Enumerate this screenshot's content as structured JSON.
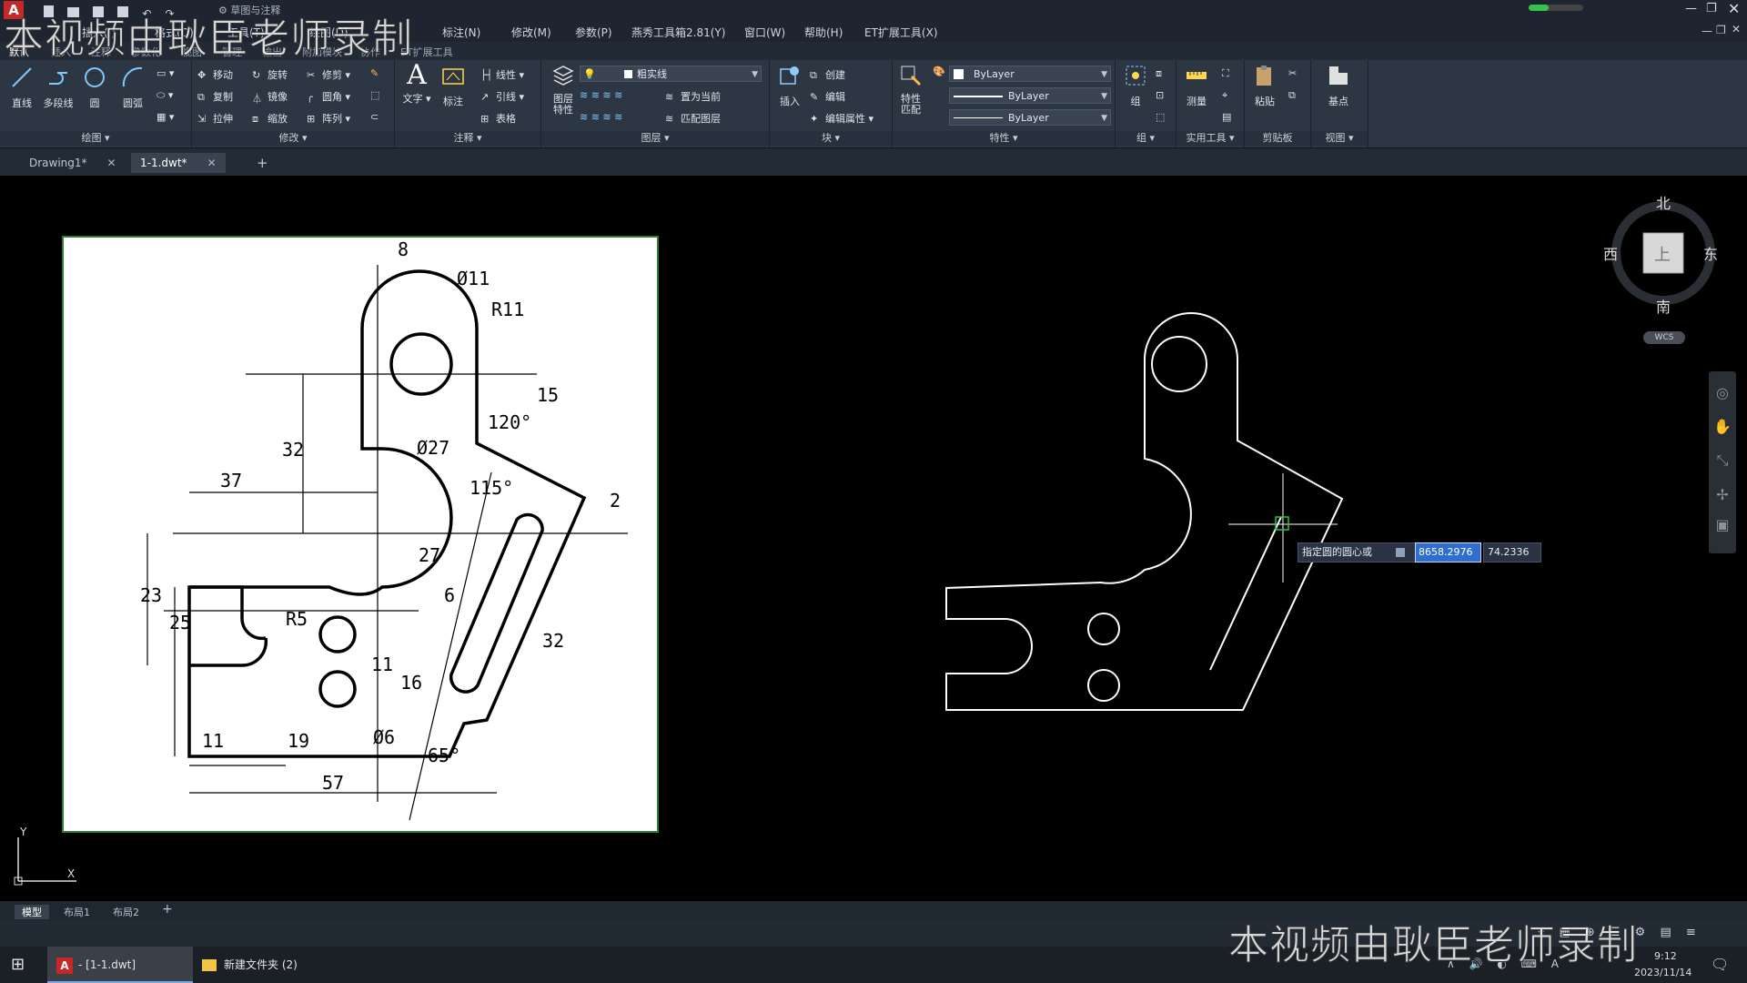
{
  "app": {
    "title_tab": "草图与注释",
    "colors": {
      "accent": "#e8333a",
      "ribbon_bg": "#2d3643",
      "canvas": "#000000",
      "paper": "#ffffff",
      "selection": "#2f6ecf",
      "geometry": "#ffffff"
    }
  },
  "menu": {
    "items": [
      "插入(I)",
      "格式(O)",
      "工具(T)",
      "绘图(D)",
      "标注(N)",
      "修改(M)",
      "参数(P)",
      "燕秀工具箱2.81(Y)",
      "窗口(W)",
      "帮助(H)",
      "ET扩展工具(X)"
    ]
  },
  "ribbon_tabs": [
    "默认",
    "插入",
    "注释",
    "参数化",
    "视图",
    "管理",
    "输出",
    "附加模块",
    "协作",
    "ET扩展工具"
  ],
  "ribbon": {
    "draw": {
      "label": "绘图",
      "tools": [
        "直线",
        "多段线",
        "圆",
        "圆弧"
      ]
    },
    "modify": {
      "label": "修改",
      "tools": [
        "移动",
        "旋转",
        "修剪",
        "复制",
        "镜像",
        "圆角",
        "拉伸",
        "缩放",
        "阵列"
      ]
    },
    "annotation": {
      "label": "注释",
      "tools": [
        "文字",
        "标注",
        "线性",
        "引线",
        "表格"
      ]
    },
    "layers": {
      "label": "图层",
      "layer_props": "图层特性",
      "current_layer": "粗实线",
      "tools": [
        "置为当前",
        "匹配图层"
      ]
    },
    "block": {
      "label": "块",
      "insert": "插入",
      "tools": [
        "创建",
        "编辑",
        "编辑属性"
      ]
    },
    "properties": {
      "label": "特性",
      "match": "特性匹配",
      "color": "ByLayer",
      "linetype": "ByLayer",
      "lineweight": "ByLayer"
    },
    "groups": {
      "label": "组",
      "tool": "组"
    },
    "utilities": {
      "label": "实用工具",
      "tool": "测量"
    },
    "clipboard": {
      "label": "剪贴板",
      "tool": "粘贴"
    },
    "view": {
      "label": "视图",
      "tool": "基点"
    }
  },
  "file_tabs": [
    {
      "name": "Drawing1*",
      "active": false
    },
    {
      "name": "1-1.dwt*",
      "active": true
    }
  ],
  "drawing_dims": {
    "d8": "8",
    "d11": "Ø11",
    "r11": "R11",
    "d15": "15",
    "a120": "120°",
    "d32": "32",
    "d27": "Ø27",
    "d37": "37",
    "a115": "115°",
    "d2": "2",
    "d27b": "27",
    "d23": "23",
    "d25": "25",
    "r5": "R5",
    "d6": "6",
    "d32b": "32",
    "d11b": "11",
    "d16": "16",
    "d11c": "11",
    "d19": "19",
    "d6dia": "Ø6",
    "a65": "65°",
    "d57": "57"
  },
  "dynamic_input": {
    "prompt": "指定圆的圆心或",
    "x_value": "8658.2976",
    "y_value": "74.2336"
  },
  "viewcube": {
    "north": "北",
    "south": "南",
    "east": "东",
    "west": "西",
    "top": "上",
    "wcs": "WCS"
  },
  "ucs": {
    "y": "Y",
    "x": "X"
  },
  "layout_tabs": [
    "模型",
    "布局1",
    "布局2"
  ],
  "taskbar": {
    "autocad_item": "- [1-1.dwt]",
    "folder_item": "新建文件夹 (2)",
    "time": "9:12",
    "date": "2023/11/14"
  },
  "watermark": "本视频由耿臣老师录制"
}
